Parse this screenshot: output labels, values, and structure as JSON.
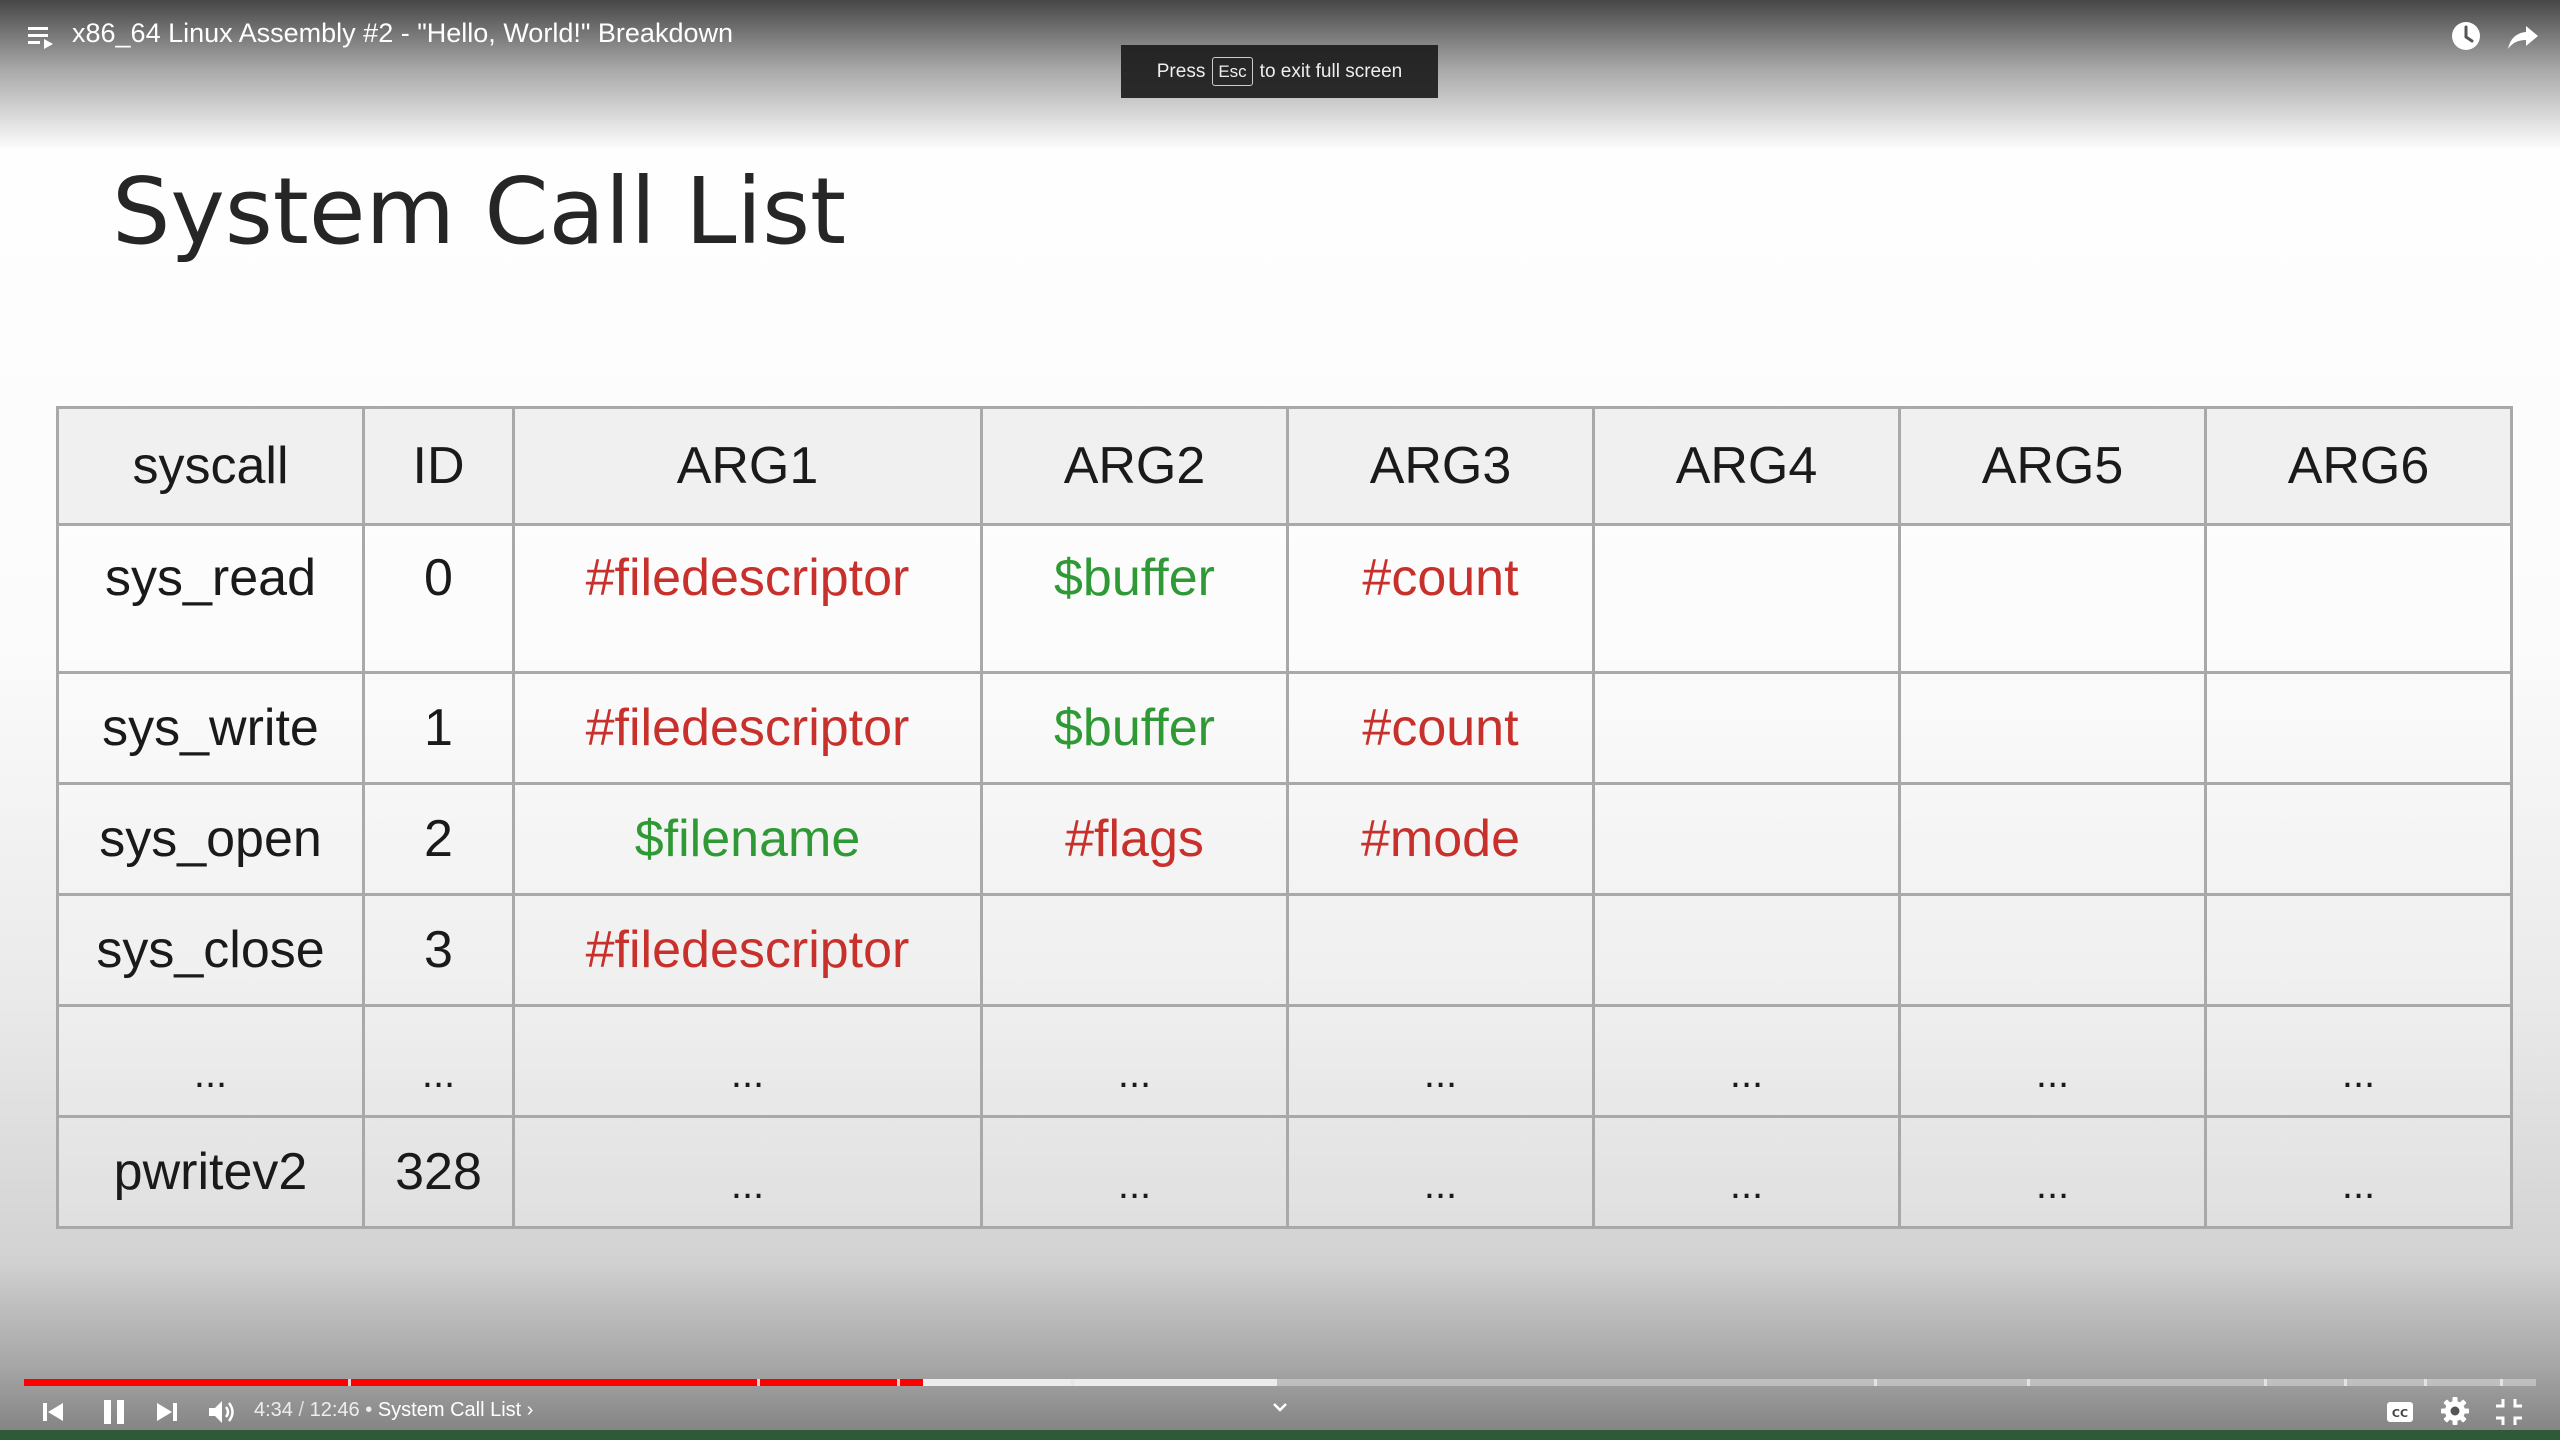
{
  "header": {
    "video_title": "x86_64 Linux Assembly #2 - \"Hello, World!\" Breakdown"
  },
  "fullscreen_toast": {
    "prefix": "Press",
    "key": "Esc",
    "suffix": "to exit full screen"
  },
  "slide": {
    "title": "System Call List",
    "table": {
      "headers": [
        "syscall",
        "ID",
        "ARG1",
        "ARG2",
        "ARG3",
        "ARG4",
        "ARG5",
        "ARG6"
      ],
      "rows": [
        [
          "sys_read",
          "0",
          "#filedescriptor",
          "$buffer",
          "#count",
          "",
          "",
          ""
        ],
        [
          "sys_write",
          "1",
          "#filedescriptor",
          "$buffer",
          "#count",
          "",
          "",
          ""
        ],
        [
          "sys_open",
          "2",
          "$filename",
          "#flags",
          "#mode",
          "",
          "",
          ""
        ],
        [
          "sys_close",
          "3",
          "#filedescriptor",
          "",
          "",
          "",
          "",
          ""
        ],
        [
          "...",
          "...",
          "...",
          "...",
          "...",
          "...",
          "...",
          "..."
        ],
        [
          "pwritev2",
          "328",
          "...",
          "...",
          "...",
          "...",
          "...",
          "..."
        ]
      ],
      "colors": {
        "register_number": "#c8302c",
        "pointer": "#2f9a35"
      }
    }
  },
  "player": {
    "current_time": "4:34",
    "separator": "/",
    "duration": "12:46",
    "chapter_bullet": "•",
    "chapter_title": "System Call List",
    "chapter_arrow": "›",
    "progress_fraction": 0.358,
    "buffered_fraction": 0.499,
    "accent_color": "#ff0000",
    "icons": [
      "playlist-icon",
      "watch-later-icon",
      "share-icon",
      "previous-icon",
      "pause-icon",
      "next-icon",
      "volume-icon",
      "chevron-down-icon",
      "closed-captions-icon",
      "settings-icon",
      "exit-fullscreen-icon"
    ]
  }
}
